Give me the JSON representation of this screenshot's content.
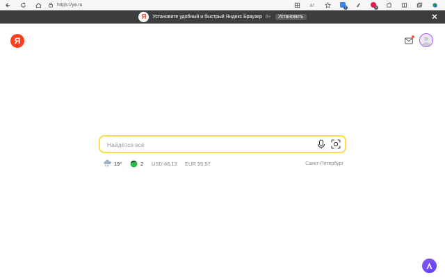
{
  "browser": {
    "url": "https://ya.ru",
    "icons": [
      "back-icon",
      "refresh-icon",
      "home-icon",
      "lock-icon",
      "tab-grid-icon",
      "read-aloud-icon",
      "favorite-icon",
      "extension-icon",
      "extension-icon",
      "extension-icon",
      "extension-icon",
      "split-icon",
      "collections-icon",
      "copilot-icon"
    ]
  },
  "banner": {
    "logo_letter": "Я",
    "text": "Установите удобный и быстрый Яндекс Браузер",
    "rating": "8+",
    "install_label": "Установить"
  },
  "header": {
    "logo_letter": "Я"
  },
  "search": {
    "placeholder": "Найдётся всё"
  },
  "informers": {
    "weather_temp": "19°",
    "traffic_score": "2",
    "usd": "USD 88,13",
    "eur": "EUR 95,57",
    "city": "Санкт-Петербург"
  },
  "colors": {
    "brand": "#fc3f1d",
    "search_border": "#ffdb4d",
    "alice": "#6b4cf6"
  }
}
